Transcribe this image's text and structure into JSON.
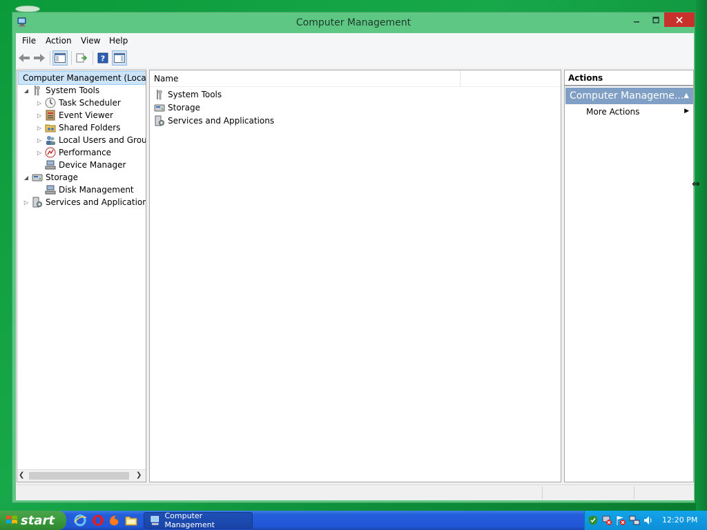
{
  "window": {
    "title": "Computer Management"
  },
  "menu": [
    "File",
    "Action",
    "View",
    "Help"
  ],
  "tree": {
    "root": "Computer Management (Local",
    "items": [
      {
        "label": "System Tools",
        "level": 1,
        "expander": "expanded"
      },
      {
        "label": "Task Scheduler",
        "level": 2,
        "expander": "collapsed"
      },
      {
        "label": "Event Viewer",
        "level": 2,
        "expander": "collapsed"
      },
      {
        "label": "Shared Folders",
        "level": 2,
        "expander": "collapsed"
      },
      {
        "label": "Local Users and Groups",
        "level": 2,
        "expander": "collapsed"
      },
      {
        "label": "Performance",
        "level": 2,
        "expander": "collapsed"
      },
      {
        "label": "Device Manager",
        "level": 2,
        "expander": "none"
      },
      {
        "label": "Storage",
        "level": 1,
        "expander": "expanded"
      },
      {
        "label": "Disk Management",
        "level": 2,
        "expander": "none"
      },
      {
        "label": "Services and Applications",
        "level": 1,
        "expander": "collapsed"
      }
    ]
  },
  "list": {
    "column_name": "Name",
    "rows": [
      "System Tools",
      "Storage",
      "Services and Applications"
    ]
  },
  "actions": {
    "header": "Actions",
    "section": "Computer Manageme...",
    "more": "More Actions"
  },
  "taskbar": {
    "start": "start",
    "task": "Computer Management",
    "clock": "12:20 PM"
  },
  "colors": {
    "desktop": "#17a84a",
    "window_frame": "#5fc784",
    "close_button": "#c7302b",
    "tree_selection": "#cce4f7",
    "actions_section": "#7f9fc4",
    "taskbar": "#245edb",
    "start_button": "#3a9a3a"
  }
}
